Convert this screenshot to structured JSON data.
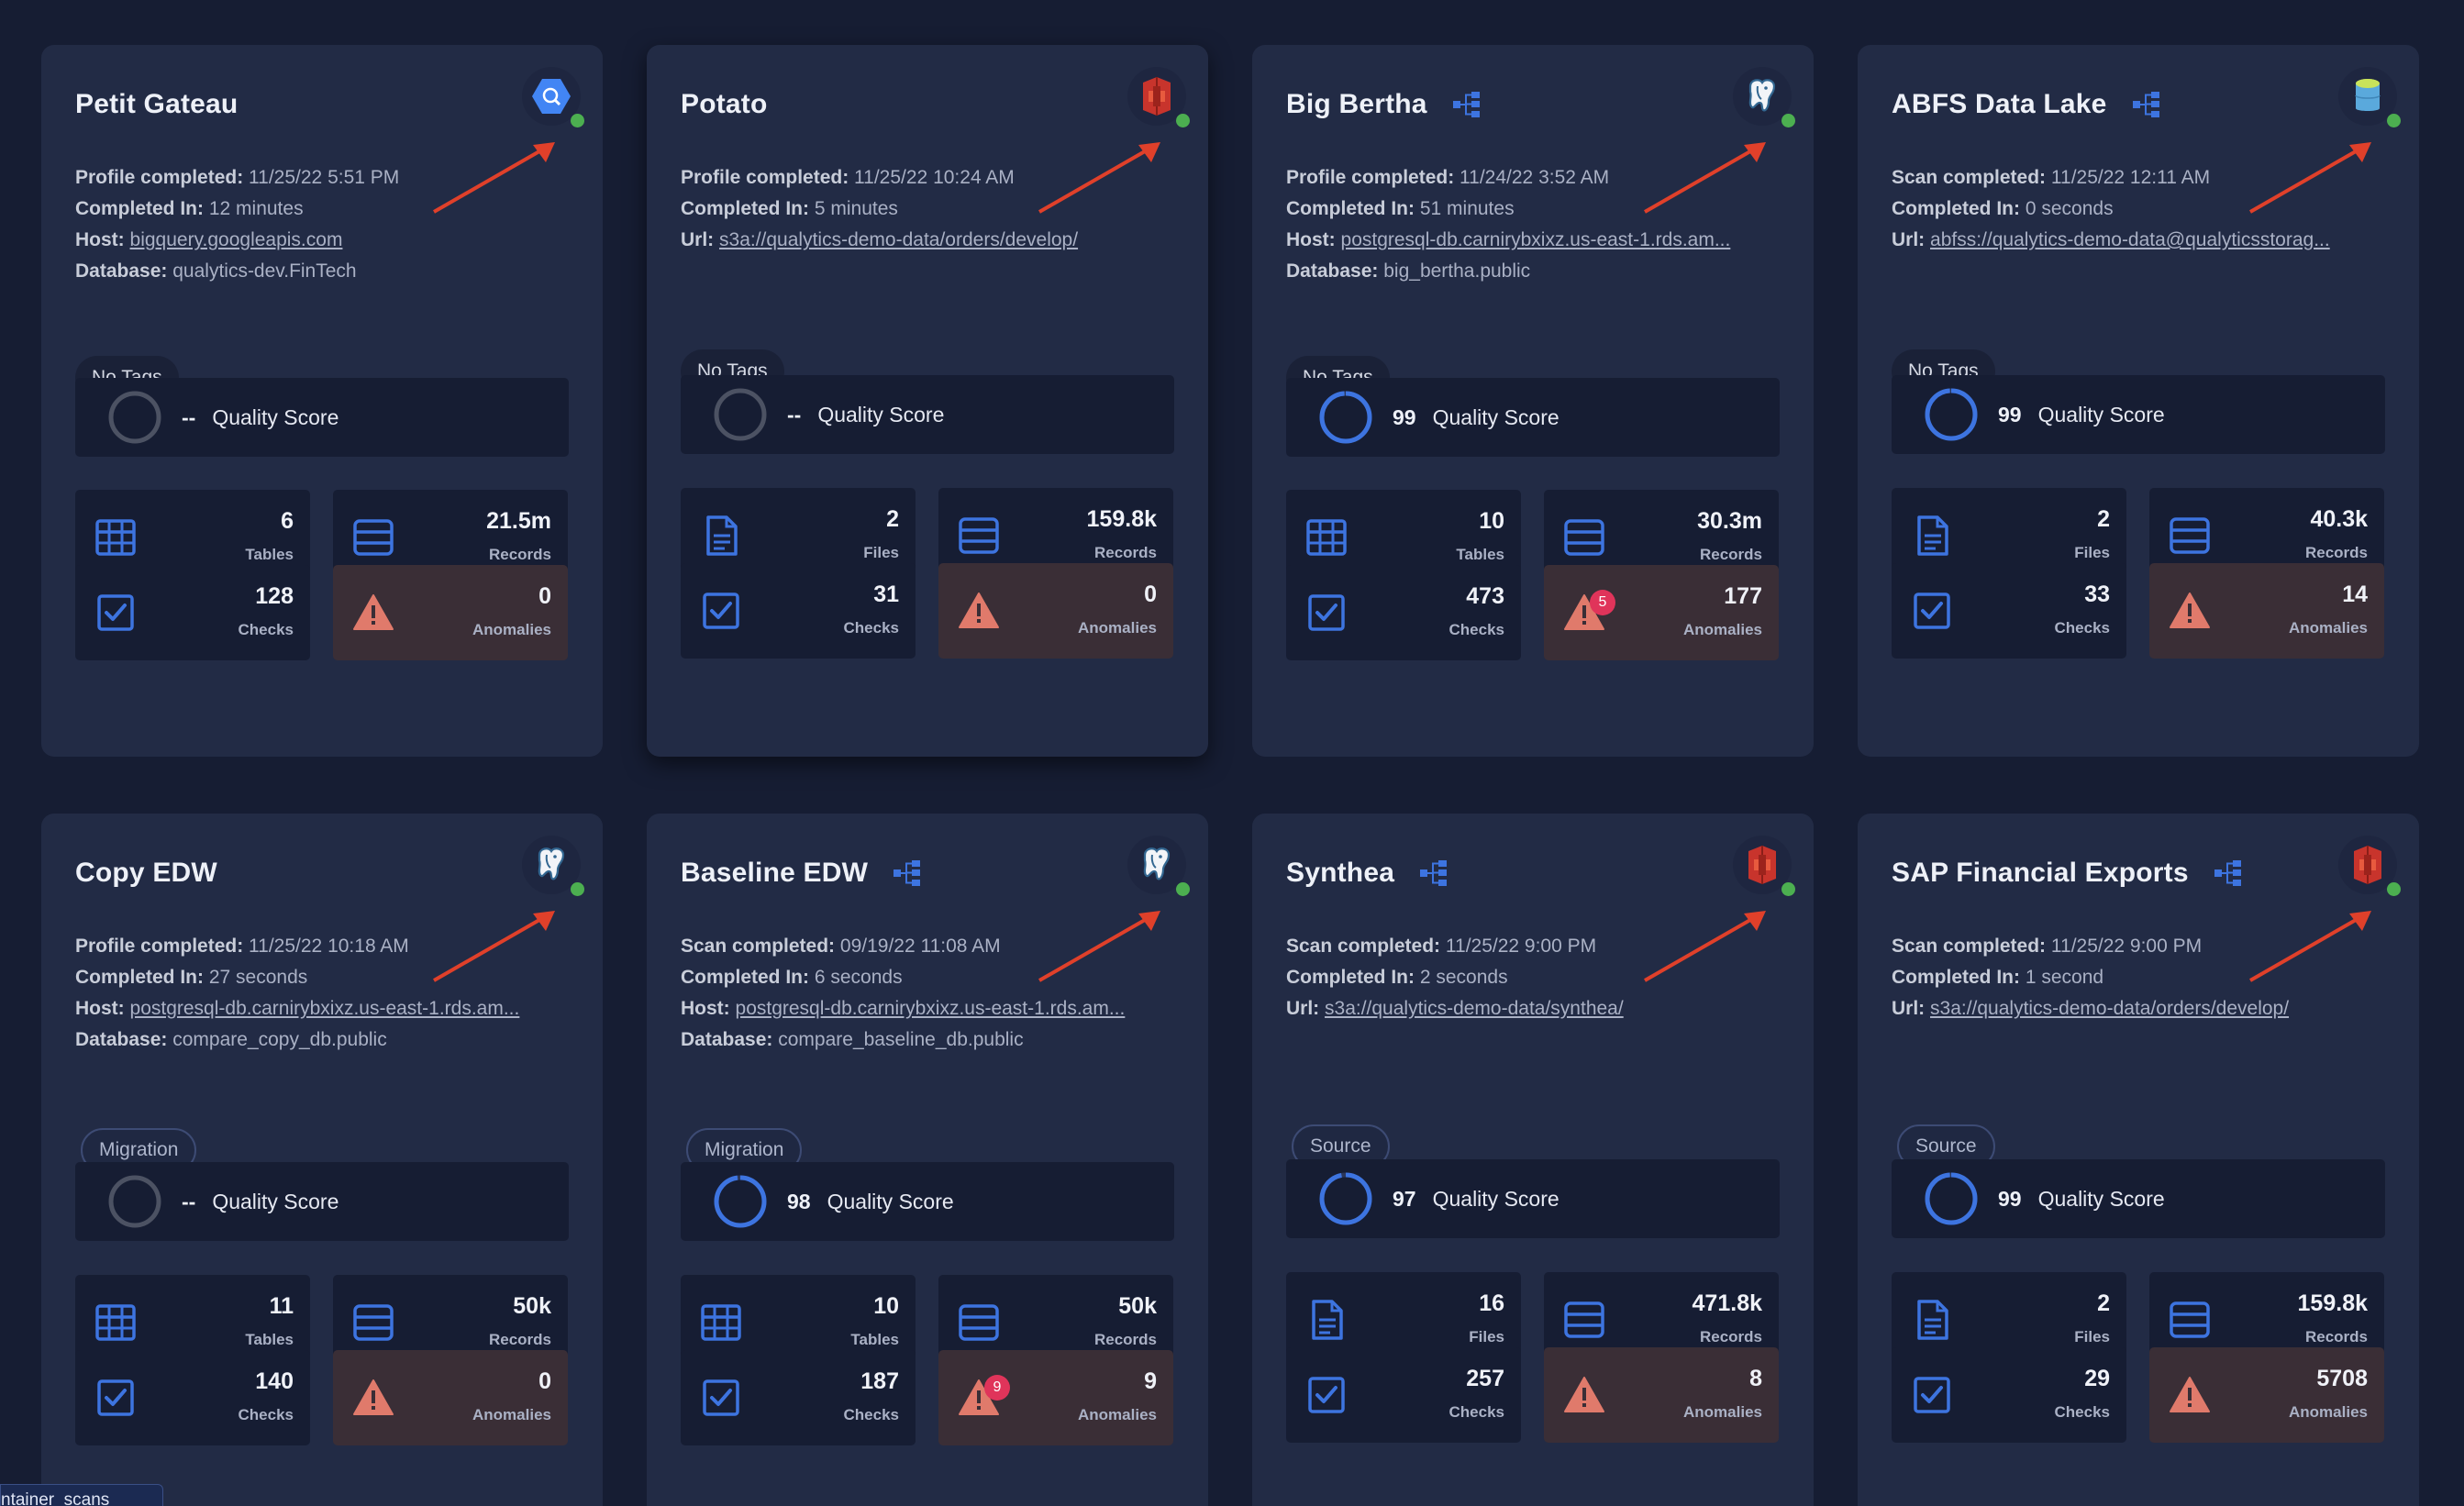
{
  "cards": [
    {
      "title": "Petit Gateau",
      "source_icon": "bigquery-icon",
      "hierarchy": false,
      "meta": [
        {
          "key": "Profile completed:",
          "value": "11/25/22 5:51 PM",
          "link": false
        },
        {
          "key": "Completed In:",
          "value": "12 minutes",
          "link": false
        },
        {
          "key": "Host:",
          "value": "bigquery.googleapis.com",
          "link": true
        },
        {
          "key": "Database:",
          "value": "qualytics-dev.FinTech",
          "link": false
        }
      ],
      "tag": "No Tags",
      "quality_score": "--",
      "quality_label": "Quality Score",
      "tiles": [
        {
          "icon": "table-icon",
          "value": "6",
          "label": "Tables"
        },
        {
          "icon": "records-icon",
          "value": "21.5m",
          "label": "Records"
        },
        {
          "icon": "checks-icon",
          "value": "128",
          "label": "Checks"
        },
        {
          "icon": "anomaly-icon",
          "value": "0",
          "label": "Anomalies"
        }
      ]
    },
    {
      "title": "Potato",
      "source_icon": "amazon-s3-icon",
      "hierarchy": false,
      "meta": [
        {
          "key": "Profile completed:",
          "value": "11/25/22 10:24 AM",
          "link": false
        },
        {
          "key": "Completed In:",
          "value": "5 minutes",
          "link": false
        },
        {
          "key": "Url:",
          "value": "s3a://qualytics-demo-data/orders/develop/",
          "link": true
        }
      ],
      "tag": "No Tags",
      "quality_score": "--",
      "quality_label": "Quality Score",
      "tiles": [
        {
          "icon": "file-icon",
          "value": "2",
          "label": "Files"
        },
        {
          "icon": "records-icon",
          "value": "159.8k",
          "label": "Records"
        },
        {
          "icon": "checks-icon",
          "value": "31",
          "label": "Checks"
        },
        {
          "icon": "anomaly-icon",
          "value": "0",
          "label": "Anomalies"
        }
      ]
    },
    {
      "title": "Big Bertha",
      "source_icon": "postgresql-icon",
      "hierarchy": true,
      "meta": [
        {
          "key": "Profile completed:",
          "value": "11/24/22 3:52 AM",
          "link": false
        },
        {
          "key": "Completed In:",
          "value": "51 minutes",
          "link": false
        },
        {
          "key": "Host:",
          "value": "postgresql-db.carnirybxixz.us-east-1.rds.am...",
          "link": true
        },
        {
          "key": "Database:",
          "value": "big_bertha.public",
          "link": false
        }
      ],
      "tag": "No Tags",
      "quality_score": "99",
      "quality_label": "Quality Score",
      "tiles": [
        {
          "icon": "table-icon",
          "value": "10",
          "label": "Tables"
        },
        {
          "icon": "records-icon",
          "value": "30.3m",
          "label": "Records"
        },
        {
          "icon": "checks-icon",
          "value": "473",
          "label": "Checks"
        },
        {
          "icon": "anomaly-icon",
          "value": "177",
          "label": "Anomalies",
          "badge": "5"
        }
      ]
    },
    {
      "title": "ABFS Data Lake",
      "source_icon": "azure-storage-icon",
      "hierarchy": true,
      "meta": [
        {
          "key": "Scan completed:",
          "value": "11/25/22 12:11 AM",
          "link": false
        },
        {
          "key": "Completed In:",
          "value": "0 seconds",
          "link": false
        },
        {
          "key": "Url:",
          "value": "abfss://qualytics-demo-data@qualyticsstorag...",
          "link": true
        }
      ],
      "tag": "No Tags",
      "quality_score": "99",
      "quality_label": "Quality Score",
      "tiles": [
        {
          "icon": "file-icon",
          "value": "2",
          "label": "Files"
        },
        {
          "icon": "records-icon",
          "value": "40.3k",
          "label": "Records"
        },
        {
          "icon": "checks-icon",
          "value": "33",
          "label": "Checks"
        },
        {
          "icon": "anomaly-icon",
          "value": "14",
          "label": "Anomalies"
        }
      ]
    },
    {
      "title": "Copy EDW",
      "source_icon": "postgresql-icon",
      "hierarchy": false,
      "meta": [
        {
          "key": "Profile completed:",
          "value": "11/25/22 10:18 AM",
          "link": false
        },
        {
          "key": "Completed In:",
          "value": "27 seconds",
          "link": false
        },
        {
          "key": "Host:",
          "value": "postgresql-db.carnirybxixz.us-east-1.rds.am...",
          "link": true
        },
        {
          "key": "Database:",
          "value": "compare_copy_db.public",
          "link": false
        }
      ],
      "tag": "Migration",
      "quality_score": "--",
      "quality_label": "Quality Score",
      "tiles": [
        {
          "icon": "table-icon",
          "value": "11",
          "label": "Tables"
        },
        {
          "icon": "records-icon",
          "value": "50k",
          "label": "Records"
        },
        {
          "icon": "checks-icon",
          "value": "140",
          "label": "Checks"
        },
        {
          "icon": "anomaly-icon",
          "value": "0",
          "label": "Anomalies"
        }
      ]
    },
    {
      "title": "Baseline EDW",
      "source_icon": "postgresql-icon",
      "hierarchy": true,
      "meta": [
        {
          "key": "Scan completed:",
          "value": "09/19/22 11:08 AM",
          "link": false
        },
        {
          "key": "Completed In:",
          "value": "6 seconds",
          "link": false
        },
        {
          "key": "Host:",
          "value": "postgresql-db.carnirybxixz.us-east-1.rds.am...",
          "link": true
        },
        {
          "key": "Database:",
          "value": "compare_baseline_db.public",
          "link": false
        }
      ],
      "tag": "Migration",
      "quality_score": "98",
      "quality_label": "Quality Score",
      "tiles": [
        {
          "icon": "table-icon",
          "value": "10",
          "label": "Tables"
        },
        {
          "icon": "records-icon",
          "value": "50k",
          "label": "Records"
        },
        {
          "icon": "checks-icon",
          "value": "187",
          "label": "Checks"
        },
        {
          "icon": "anomaly-icon",
          "value": "9",
          "label": "Anomalies",
          "badge": "9"
        }
      ]
    },
    {
      "title": "Synthea",
      "source_icon": "amazon-s3-icon",
      "hierarchy": true,
      "meta": [
        {
          "key": "Scan completed:",
          "value": "11/25/22 9:00 PM",
          "link": false
        },
        {
          "key": "Completed In:",
          "value": "2 seconds",
          "link": false
        },
        {
          "key": "Url:",
          "value": "s3a://qualytics-demo-data/synthea/",
          "link": true
        }
      ],
      "tag": "Source",
      "quality_score": "97",
      "quality_label": "Quality Score",
      "tiles": [
        {
          "icon": "file-icon",
          "value": "16",
          "label": "Files"
        },
        {
          "icon": "records-icon",
          "value": "471.8k",
          "label": "Records"
        },
        {
          "icon": "checks-icon",
          "value": "257",
          "label": "Checks"
        },
        {
          "icon": "anomaly-icon",
          "value": "8",
          "label": "Anomalies"
        }
      ]
    },
    {
      "title": "SAP Financial Exports",
      "source_icon": "amazon-s3-icon",
      "hierarchy": true,
      "meta": [
        {
          "key": "Scan completed:",
          "value": "11/25/22 9:00 PM",
          "link": false
        },
        {
          "key": "Completed In:",
          "value": "1 second",
          "link": false
        },
        {
          "key": "Url:",
          "value": "s3a://qualytics-demo-data/orders/develop/",
          "link": true
        }
      ],
      "tag": "Source",
      "quality_score": "99",
      "quality_label": "Quality Score",
      "tiles": [
        {
          "icon": "file-icon",
          "value": "2",
          "label": "Files"
        },
        {
          "icon": "records-icon",
          "value": "159.8k",
          "label": "Records"
        },
        {
          "icon": "checks-icon",
          "value": "29",
          "label": "Checks"
        },
        {
          "icon": "anomaly-icon",
          "value": "5708",
          "label": "Anomalies"
        }
      ]
    }
  ],
  "tooltip": "ntainer_scans",
  "colors": {
    "background": "#161d33",
    "card": "#222b45",
    "accent": "#3d74e0",
    "status_ok": "#4caf50",
    "anomaly": "#e07a6b",
    "annotation_arrow": "#e0402a"
  }
}
